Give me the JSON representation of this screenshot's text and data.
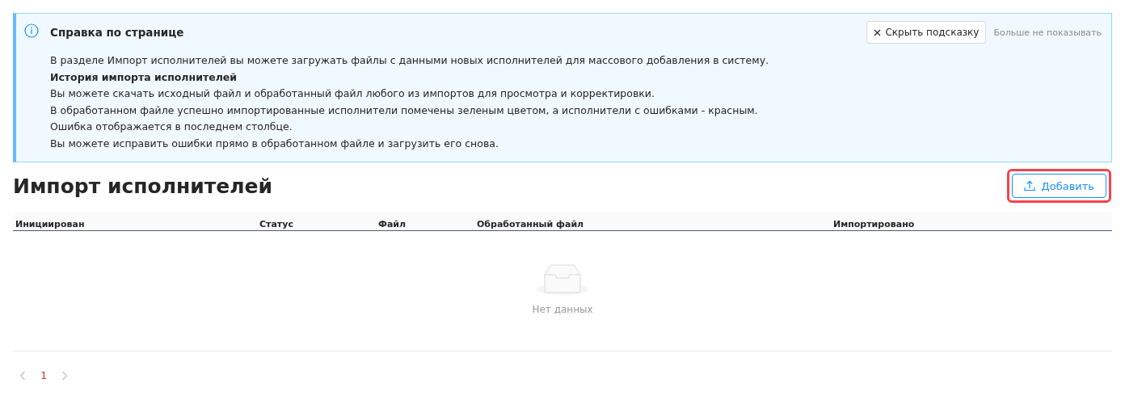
{
  "help_alert": {
    "title": "Справка по странице",
    "hide_button": "Скрыть подсказку",
    "dont_show_link": "Больше не показывать",
    "lines": [
      {
        "kind": "text",
        "text": "В разделе Импорт исполнителей вы можете загружать файлы с данными новых исполнителей для массового добавления в систему."
      },
      {
        "kind": "heading",
        "text": "История импорта исполнителей"
      },
      {
        "kind": "text",
        "text": "Вы можете скачать исходный файл и обработанный файл любого из импортов для просмотра и корректировки."
      },
      {
        "kind": "text",
        "text": "В обработанном файле успешно импортированные исполнители помечены зеленым цветом, а исполнители с ошибками - красным."
      },
      {
        "kind": "text",
        "text": "Ошибка отображается в последнем столбце."
      },
      {
        "kind": "text",
        "text": "Вы можете исправить ошибки прямо в обработанном файле и загрузить его снова."
      }
    ]
  },
  "page_title": "Импорт исполнителей",
  "add_button": {
    "label": "Добавить"
  },
  "table": {
    "columns": [
      "Инициирован",
      "Статус",
      "Файл",
      "Обработанный файл",
      "Импортировано"
    ],
    "empty_text": "Нет данных"
  },
  "pagination": {
    "pages": [
      {
        "label": "1",
        "selected": true
      }
    ]
  }
}
